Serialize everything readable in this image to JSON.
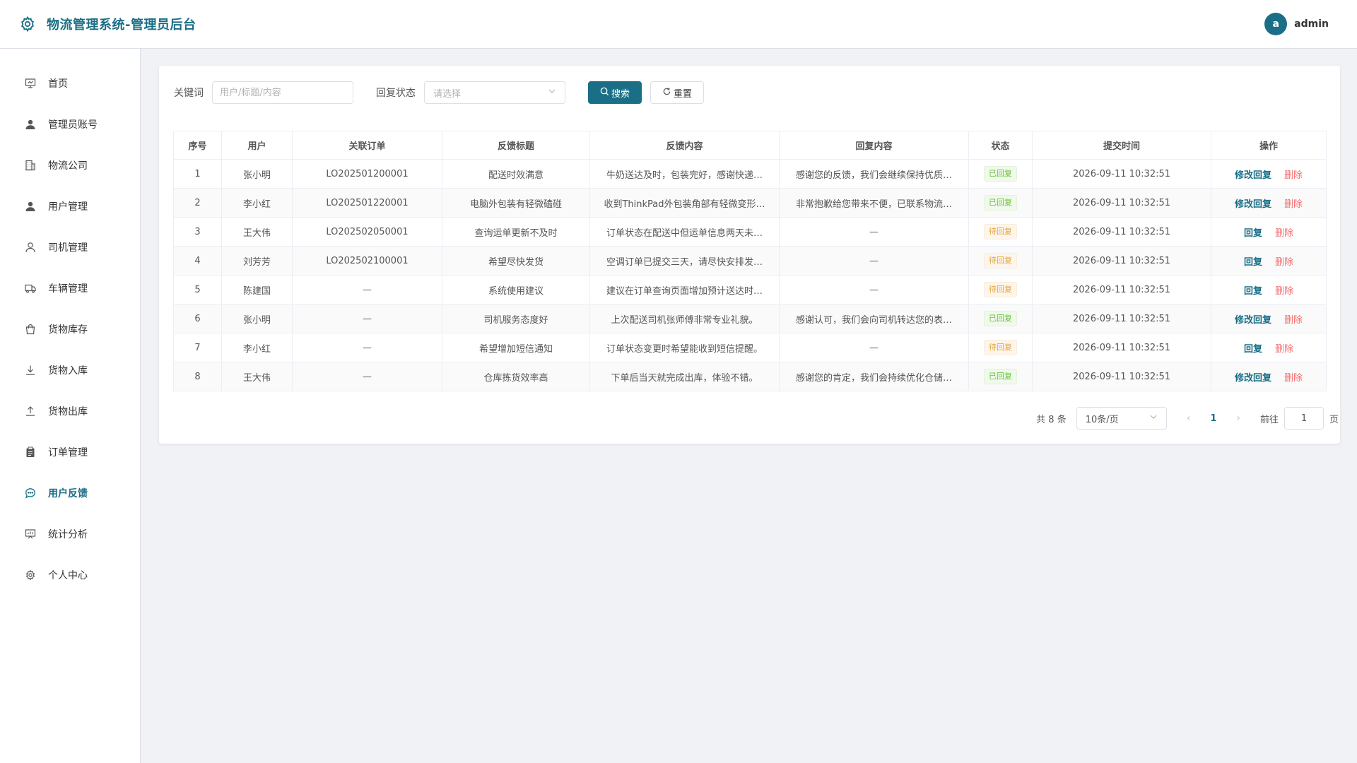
{
  "app": {
    "title": "物流管理系统-管理员后台"
  },
  "user": {
    "avatar_letter": "a",
    "name": "admin"
  },
  "sidebar": {
    "items": [
      {
        "label": "首页",
        "icon": "monitor-icon"
      },
      {
        "label": "管理员账号",
        "icon": "user-filled-icon"
      },
      {
        "label": "物流公司",
        "icon": "office-building-icon"
      },
      {
        "label": "用户管理",
        "icon": "user-filled-icon"
      },
      {
        "label": "司机管理",
        "icon": "user-icon"
      },
      {
        "label": "车辆管理",
        "icon": "truck-icon"
      },
      {
        "label": "货物库存",
        "icon": "bag-icon"
      },
      {
        "label": "货物入库",
        "icon": "download-icon"
      },
      {
        "label": "货物出库",
        "icon": "upload-icon"
      },
      {
        "label": "订单管理",
        "icon": "clipboard-icon"
      },
      {
        "label": "用户反馈",
        "icon": "chat-icon",
        "active": true
      },
      {
        "label": "统计分析",
        "icon": "data-board-icon"
      },
      {
        "label": "个人中心",
        "icon": "gear-icon"
      }
    ]
  },
  "filter": {
    "keyword_label": "关键词",
    "keyword_placeholder": "用户/标题/内容",
    "status_label": "回复状态",
    "status_placeholder": "请选择",
    "search_label": "搜索",
    "reset_label": "重置"
  },
  "table": {
    "columns": [
      "序号",
      "用户",
      "关联订单",
      "反馈标题",
      "反馈内容",
      "回复内容",
      "状态",
      "提交时间",
      "操作"
    ],
    "rows": [
      {
        "no": "1",
        "user": "张小明",
        "order": "LO202501200001",
        "title": "配送时效满意",
        "content": "牛奶送达及时，包装完好，感谢快递…",
        "reply": "感谢您的反馈，我们会继续保持优质…",
        "status": "已回复",
        "time": "2026-09-11 10:32:51",
        "op": "修改回复",
        "del": "删除"
      },
      {
        "no": "2",
        "user": "李小红",
        "order": "LO202501220001",
        "title": "电脑外包装有轻微磕碰",
        "content": "收到ThinkPad外包装角部有轻微变形…",
        "reply": "非常抱歉给您带来不便，已联系物流…",
        "status": "已回复",
        "time": "2026-09-11 10:32:51",
        "op": "修改回复",
        "del": "删除"
      },
      {
        "no": "3",
        "user": "王大伟",
        "order": "LO202502050001",
        "title": "查询运单更新不及时",
        "content": "订单状态在配送中但运单信息两天未…",
        "reply": "—",
        "status": "待回复",
        "time": "2026-09-11 10:32:51",
        "op": "回复",
        "del": "删除"
      },
      {
        "no": "4",
        "user": "刘芳芳",
        "order": "LO202502100001",
        "title": "希望尽快发货",
        "content": "空调订单已提交三天，请尽快安排发…",
        "reply": "—",
        "status": "待回复",
        "time": "2026-09-11 10:32:51",
        "op": "回复",
        "del": "删除"
      },
      {
        "no": "5",
        "user": "陈建国",
        "order": "—",
        "title": "系统使用建议",
        "content": "建议在订单查询页面增加预计送达时…",
        "reply": "—",
        "status": "待回复",
        "time": "2026-09-11 10:32:51",
        "op": "回复",
        "del": "删除"
      },
      {
        "no": "6",
        "user": "张小明",
        "order": "—",
        "title": "司机服务态度好",
        "content": "上次配送司机张师傅非常专业礼貌。",
        "reply": "感谢认可，我们会向司机转达您的表…",
        "status": "已回复",
        "time": "2026-09-11 10:32:51",
        "op": "修改回复",
        "del": "删除"
      },
      {
        "no": "7",
        "user": "李小红",
        "order": "—",
        "title": "希望增加短信通知",
        "content": "订单状态变更时希望能收到短信提醒。",
        "reply": "—",
        "status": "待回复",
        "time": "2026-09-11 10:32:51",
        "op": "回复",
        "del": "删除"
      },
      {
        "no": "8",
        "user": "王大伟",
        "order": "—",
        "title": "仓库拣货效率高",
        "content": "下单后当天就完成出库，体验不错。",
        "reply": "感谢您的肯定，我们会持续优化仓储…",
        "status": "已回复",
        "time": "2026-09-11 10:32:51",
        "op": "修改回复",
        "del": "删除"
      }
    ]
  },
  "pagination": {
    "total": "共 8 条",
    "page_size": "10条/页",
    "current_page": "1",
    "goto_label": "前往",
    "goto_value": "1",
    "page_suffix": "页"
  },
  "colors": {
    "primary": "#1a6e86",
    "success": "#67c23a",
    "warning": "#e6a23c",
    "danger": "#f56c6c"
  }
}
